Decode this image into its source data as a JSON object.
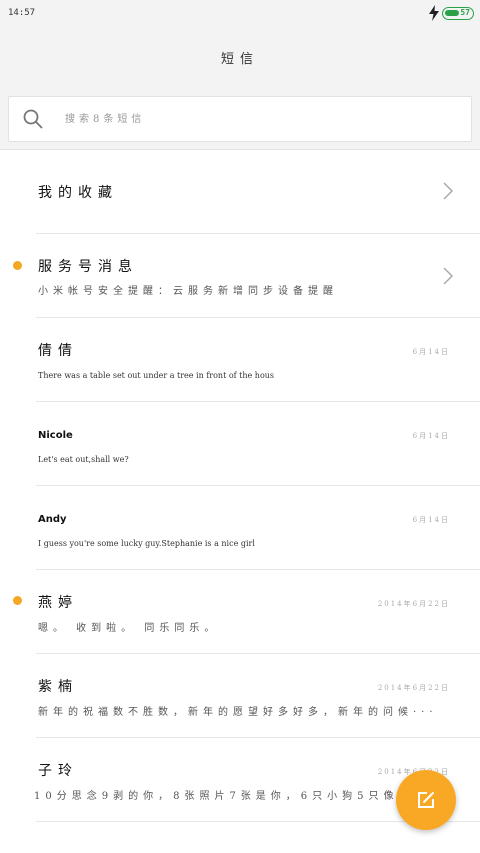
{
  "status_bar": {
    "time": "14:57",
    "battery_level": "57",
    "battery_fraction": 0.57,
    "accent_color": "#2aa148"
  },
  "header": {
    "title": "短信"
  },
  "search": {
    "placeholder": "搜索8条短信"
  },
  "favorites": {
    "title": "我的收藏"
  },
  "conversations": [
    {
      "title": "服务号消息",
      "preview": "小米帐号安全提醒：云服务新增同步设备提醒",
      "date": "",
      "unread": true,
      "chevron": true
    },
    {
      "title": "倩倩",
      "preview": "There was a table set out under a tree in front of the hous",
      "date": "6月14日",
      "unread": false
    },
    {
      "title": "Nicole",
      "preview": "Let's eat out,shall we?",
      "date": "6月14日",
      "unread": false
    },
    {
      "title": "Andy",
      "preview": "I guess you're some lucky guy.Stephanie is a nice girl",
      "date": "6月14日",
      "unread": false
    },
    {
      "title": "燕婷",
      "preview": "嗯。 收到啦。 同乐同乐。",
      "date": "2014年6月22日",
      "unread": true
    },
    {
      "title": "紫楠",
      "preview": "新年的祝福数不胜数，新年的愿望好多好多，新年的问候···",
      "date": "2014年6月22日",
      "unread": false
    },
    {
      "title": "子玲",
      "preview": "10分思念9剥的你，8张照片7张是你，6只小狗5只像你，",
      "date": "2014年6月22日",
      "unread": false
    }
  ],
  "compose": {
    "color": "#f9a825",
    "icon": "compose-icon"
  }
}
